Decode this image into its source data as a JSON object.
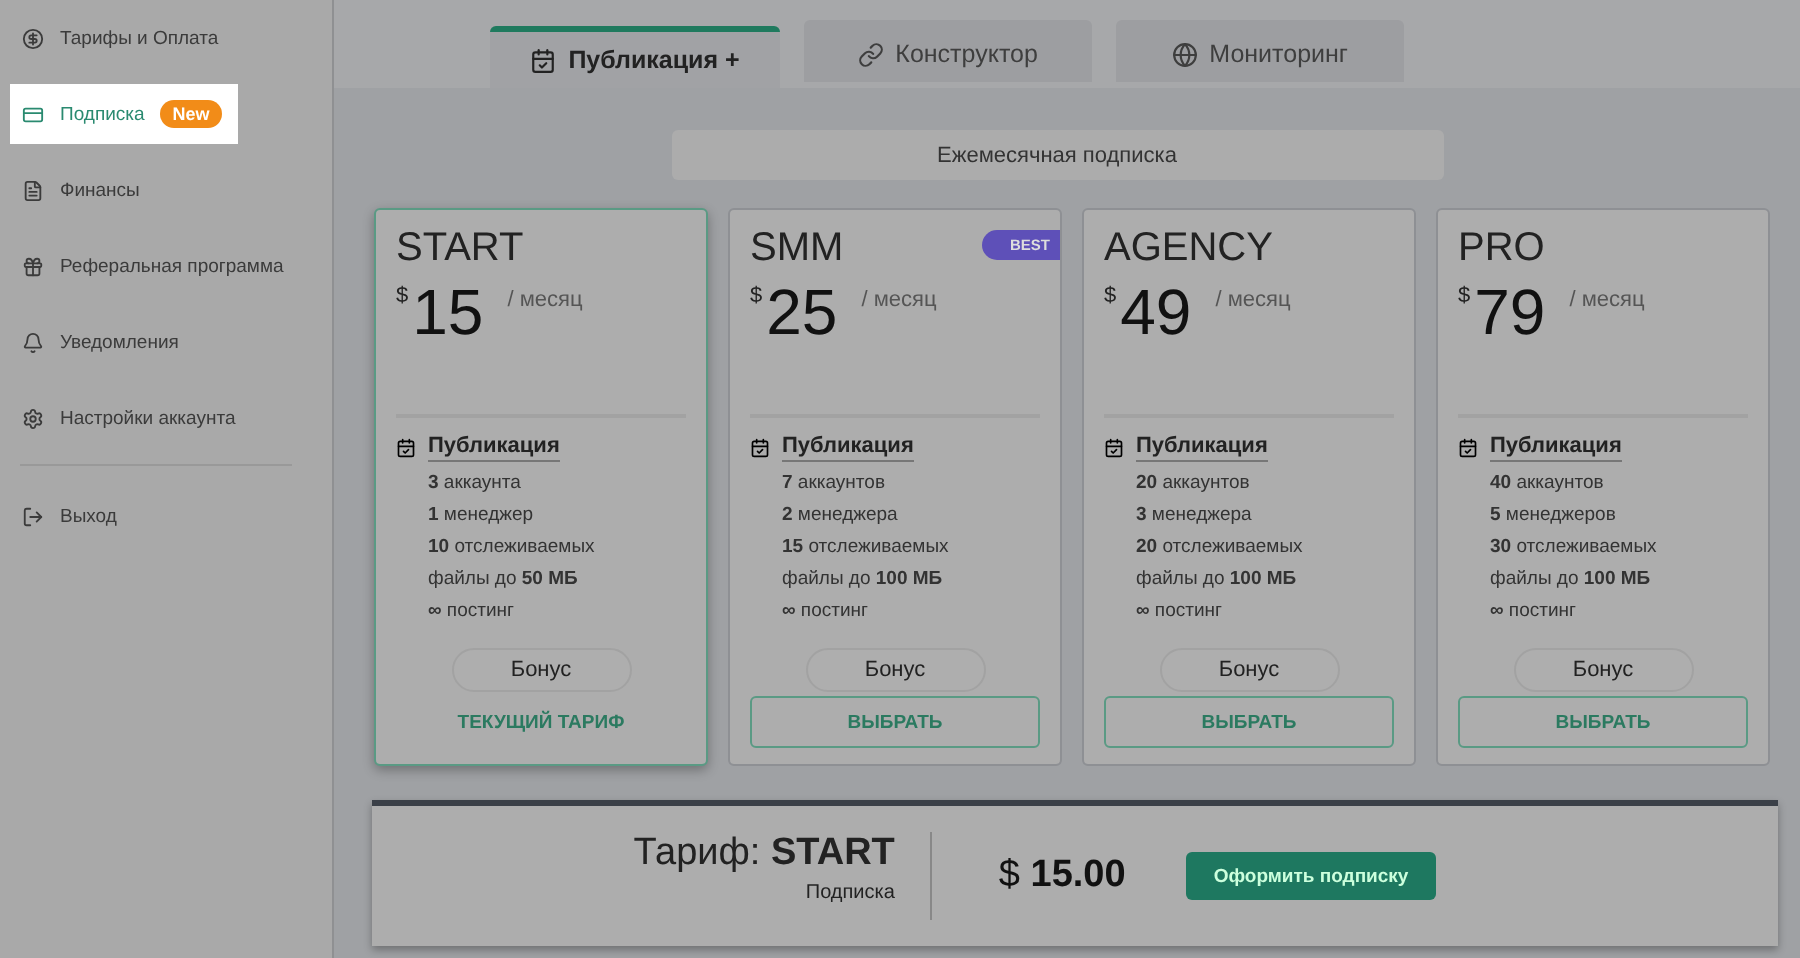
{
  "sidebar": {
    "items": [
      {
        "label": "Тарифы и Оплата",
        "selected": false
      },
      {
        "label": "Подписка",
        "selected": true,
        "badge": "New"
      },
      {
        "label": "Финансы",
        "selected": false
      },
      {
        "label": "Реферальная программа",
        "selected": false
      },
      {
        "label": "Уведомления",
        "selected": false
      },
      {
        "label": "Настройки аккаунта",
        "selected": false
      },
      {
        "label": "Выход",
        "selected": false
      }
    ]
  },
  "tabs": [
    {
      "label": "Публикация +",
      "selected": true
    },
    {
      "label": "Конструктор",
      "selected": false
    },
    {
      "label": "Мониторинг",
      "selected": false
    }
  ],
  "period": "Ежемесячная подписка",
  "plans": [
    {
      "name": "START",
      "currency": "$",
      "price": "15",
      "per": "/ месяц",
      "section": "Публикация",
      "features": [
        "**3** аккаунта",
        "**1** менеджер",
        "**10** отслеживаемых",
        "файлы до **50 МБ**",
        "**∞** постинг"
      ],
      "bonus": "Бонус",
      "action": "ТЕКУЩИЙ ТАРИФ",
      "selected": true
    },
    {
      "name": "SMM",
      "currency": "$",
      "price": "25",
      "per": "/ месяц",
      "badge": "BEST",
      "section": "Публикация",
      "features": [
        "**7** аккаунтов",
        "**2** менеджера",
        "**15** отслеживаемых",
        "файлы до **100 МБ**",
        "**∞** постинг"
      ],
      "bonus": "Бонус",
      "action": "ВЫБРАТЬ",
      "selected": false
    },
    {
      "name": "AGENCY",
      "currency": "$",
      "price": "49",
      "per": "/ месяц",
      "section": "Публикация",
      "features": [
        "**20** аккаунтов",
        "**3** менеджера",
        "**20** отслеживаемых",
        "файлы до **100 МБ**",
        "**∞** постинг"
      ],
      "bonus": "Бонус",
      "action": "ВЫБРАТЬ",
      "selected": false
    },
    {
      "name": "PRO",
      "currency": "$",
      "price": "79",
      "per": "/ месяц",
      "section": "Публикация",
      "features": [
        "**40** аккаунтов",
        "**5** менеджеров",
        "**30** отслеживаемых",
        "файлы до **100 МБ**",
        "**∞** постинг"
      ],
      "bonus": "Бонус",
      "action": "ВЫБРАТЬ",
      "selected": false
    }
  ],
  "summary": {
    "label": "Тариф: **START**",
    "sublabel": "Подписка",
    "total": "$ **15.00**",
    "button": "Оформить подписку"
  }
}
